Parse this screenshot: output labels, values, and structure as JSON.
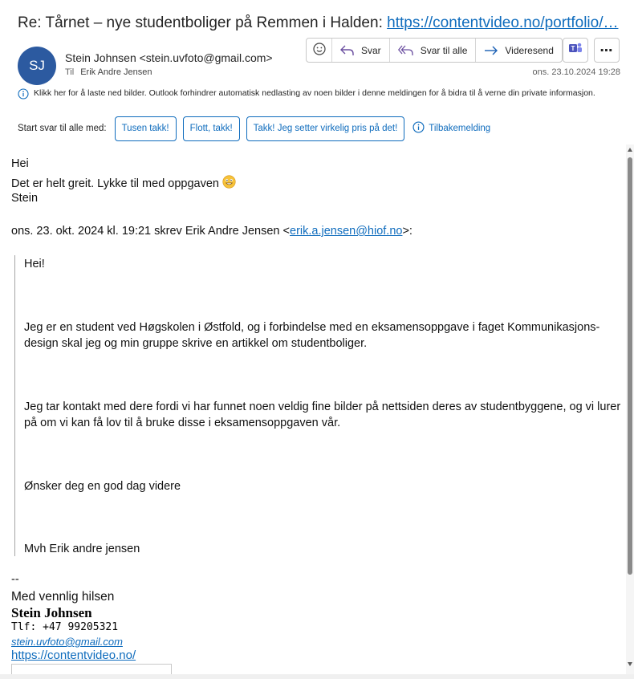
{
  "subject": {
    "text": "Re: Tårnet – nye studentboliger på Remmen i Halden: ",
    "link": "https://contentvideo.no/portfolio/…"
  },
  "sender": {
    "initials": "SJ",
    "display": "Stein Johnsen <stein.uvfoto@gmail.com>",
    "to_label": "Til",
    "to_name": "Erik Andre Jensen",
    "avatar_color": "#2c5aa0"
  },
  "actions": {
    "reply": "Svar",
    "reply_all": "Svar til alle",
    "forward": "Videresend"
  },
  "timestamp": "ons. 23.10.2024 19:28",
  "info_bar": "Klikk her for å laste ned bilder. Outlook forhindrer automatisk nedlasting av noen bilder i denne meldingen for å bidra til å verne din private informasjon.",
  "quick_replies": {
    "label": "Start svar til alle med:",
    "options": [
      "Tusen takk!",
      "Flott, takk!",
      "Takk! Jeg setter virkelig pris på det!"
    ],
    "recall": "Tilbakemelding"
  },
  "body": {
    "line1": "Hei",
    "line2": "Det er helt greit. Lykke til med oppgaven",
    "line3": "Stein",
    "quote_header_prefix": "ons. 23. okt. 2024 kl. 19:21 skrev Erik Andre Jensen <",
    "quote_header_email": "erik.a.jensen@hiof.no",
    "quote_header_suffix": ">:"
  },
  "quote": {
    "p1": "Hei!",
    "p2": "Jeg er en student ved Høgskolen i Østfold, og i forbindelse med en eksamensoppgave i faget Kommunikasjons-design skal jeg og min gruppe skrive en artikkel om studentboliger.",
    "p3": "Jeg tar kontakt med dere fordi vi har funnet noen veldig fine bilder på nettsiden deres av studentbyggene, og vi lurer på om vi kan få lov til å bruke disse i eksamensoppgaven vår.",
    "p4": "Ønsker deg en god dag videre",
    "p5": "Mvh Erik andre jensen"
  },
  "signature": {
    "dash": "--",
    "greeting": "Med vennlig hilsen",
    "name": "Stein Johnsen",
    "phone": "Tlf: +47 99205321",
    "email": "stein.uvfoto@gmail.com",
    "url": "https://contentvideo.no/"
  },
  "colors": {
    "accent": "#0f6cbd",
    "reply_icon": "#6b4fa0",
    "info_icon": "#0f6cbd"
  }
}
